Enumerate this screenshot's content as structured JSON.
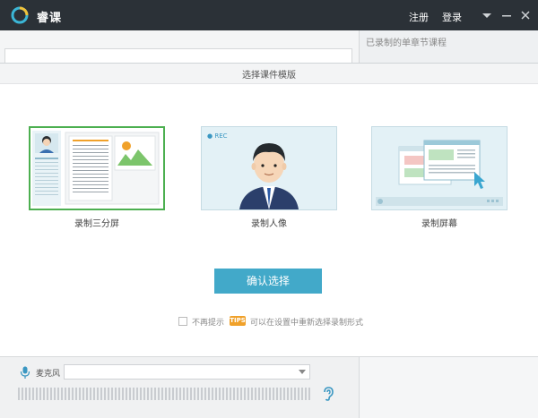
{
  "app": {
    "name": "睿课"
  },
  "titlebar": {
    "register": "注册",
    "login": "登录"
  },
  "right_panel": {
    "title": "已录制的单章节课程"
  },
  "modal": {
    "title": "选择课件模版",
    "templates": [
      {
        "label": "录制三分屏",
        "selected": true
      },
      {
        "label": "录制人像",
        "selected": false,
        "badge": "● REC"
      },
      {
        "label": "录制屏幕",
        "selected": false
      }
    ],
    "confirm": "确认选择",
    "dont_remind": "不再提示",
    "tips_badge": "TIPS",
    "tips_text": "可以在设置中重新选择录制形式"
  },
  "bottom": {
    "mic_label": "麦克风",
    "mic_value": ""
  },
  "colors": {
    "titlebar": "#2b3137",
    "accent": "#42a9c9",
    "selected_border": "#4caf50",
    "tips": "#f0a12a"
  }
}
